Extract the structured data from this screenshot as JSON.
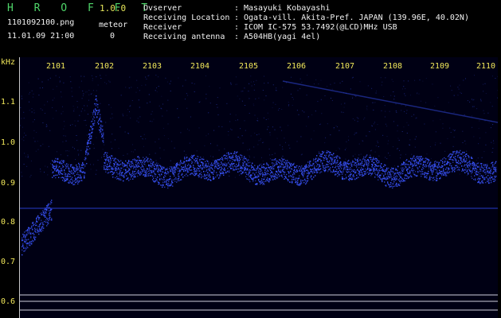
{
  "app": {
    "name": "H R O F F T",
    "version": "1.0.0"
  },
  "file": {
    "name": "1101092100.png",
    "datetime": "11.01.09 21:00"
  },
  "meteor": {
    "label": "meteor",
    "count": "0"
  },
  "info": [
    {
      "label": "Ovserver",
      "sep": ":",
      "value": "Masayuki Kobayashi"
    },
    {
      "label": "Receiving Location",
      "sep": ":",
      "value": "Ogata-vill. Akita-Pref. JAPAN (139.96E, 40.02N)"
    },
    {
      "label": "Receiver",
      "sep": ":",
      "value": "ICOM IC-575 53.7492(@LCD)MHz USB"
    },
    {
      "label": "Receiving antenna",
      "sep": ":",
      "value": "A504HB(yagi 4el)"
    }
  ],
  "axis": {
    "ylabel": "kHz",
    "y_ticks": [
      "1.1",
      "1.0",
      "0.9",
      "0.8",
      "0.7",
      "0.6"
    ],
    "x_ticks": [
      "2101",
      "2102",
      "2103",
      "2104",
      "2105",
      "2106",
      "2107",
      "2108",
      "2109",
      "2110"
    ]
  },
  "colors": {
    "background": "#000014",
    "signal": "#3a55ff",
    "text": "#f2f2f2",
    "accent": "#f2e85a",
    "logo": "#4fd66a"
  }
}
